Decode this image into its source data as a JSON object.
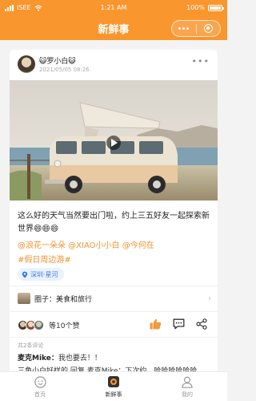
{
  "status_bar": {
    "carrier": "ISEE",
    "time": "1:21 AM",
    "battery": "100%"
  },
  "nav": {
    "title": "新鲜事"
  },
  "post": {
    "username": "😺罗小白😺",
    "date": "2021/05/05 08:26",
    "text": "这么好的天气当然要出门啦，约上三五好友一起探索新世界😄😄😄",
    "mentions": "@浪花一朵朵 @XIAO小小白 @今何在",
    "hashtag": "#假日周边游#",
    "location": "深圳·星河",
    "circle": "圈子：美食和旅行",
    "likes": "等10个赞",
    "comment_count": "共2条评论",
    "comment_1_author": "麦克Mike：",
    "comment_1_text": "我也要去！！",
    "comment_2": "三角小白好样的 回复 麦克Mike：下次约，哈哈哈哈哈哈"
  },
  "tabs": [
    {
      "label": "首页"
    },
    {
      "label": "新鲜事"
    },
    {
      "label": "我的"
    }
  ],
  "colors": {
    "accent": "#f9962e",
    "link": "#f09232",
    "like": "#f39a3a"
  }
}
